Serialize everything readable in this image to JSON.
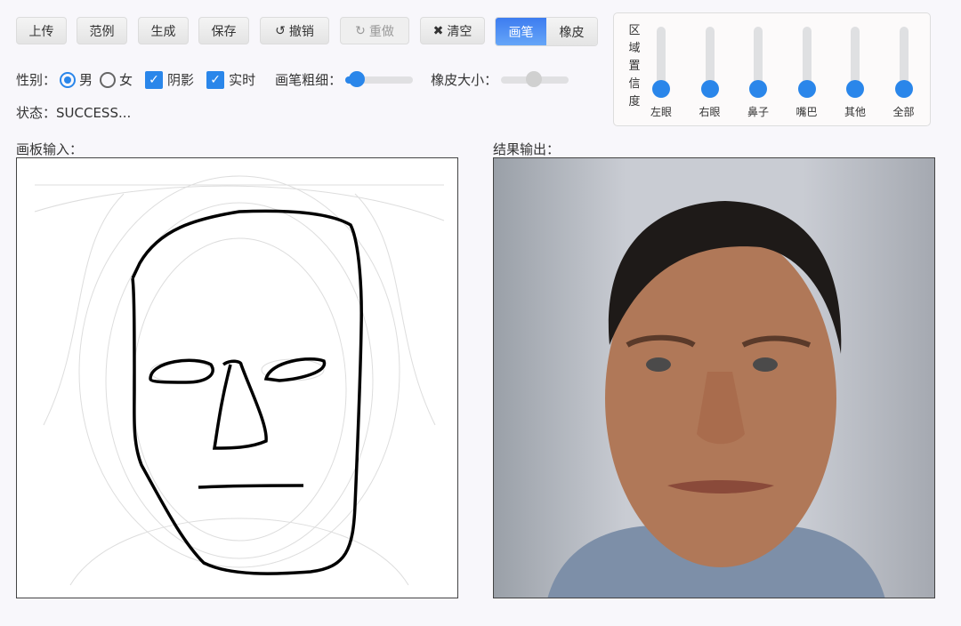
{
  "toolbar": {
    "upload": "上传",
    "example": "范例",
    "generate": "生成",
    "save": "保存",
    "undo": "撤销",
    "redo": "重做",
    "clear": "清空",
    "brush": "画笔",
    "eraser": "橡皮"
  },
  "options": {
    "gender_label": "性别：",
    "male": "男",
    "female": "女",
    "shadow": "阴影",
    "realtime": "实时",
    "brush_size_label": "画笔粗细：",
    "eraser_size_label": "橡皮大小：",
    "brush_size": 0.15,
    "eraser_size": 0.5
  },
  "status": "状态：SUCCESS...",
  "confidence": {
    "title": [
      "区",
      "域",
      "置",
      "信",
      "度"
    ],
    "sliders": [
      {
        "label": "左眼",
        "value": 0.12
      },
      {
        "label": "右眼",
        "value": 0.12
      },
      {
        "label": "鼻子",
        "value": 0.12
      },
      {
        "label": "嘴巴",
        "value": 0.12
      },
      {
        "label": "其他",
        "value": 0.12
      },
      {
        "label": "全部",
        "value": 0.12
      }
    ]
  },
  "canvas_label": "画板输入：",
  "result_label": "结果输出：",
  "colors": {
    "accent": "#2a86ea"
  }
}
